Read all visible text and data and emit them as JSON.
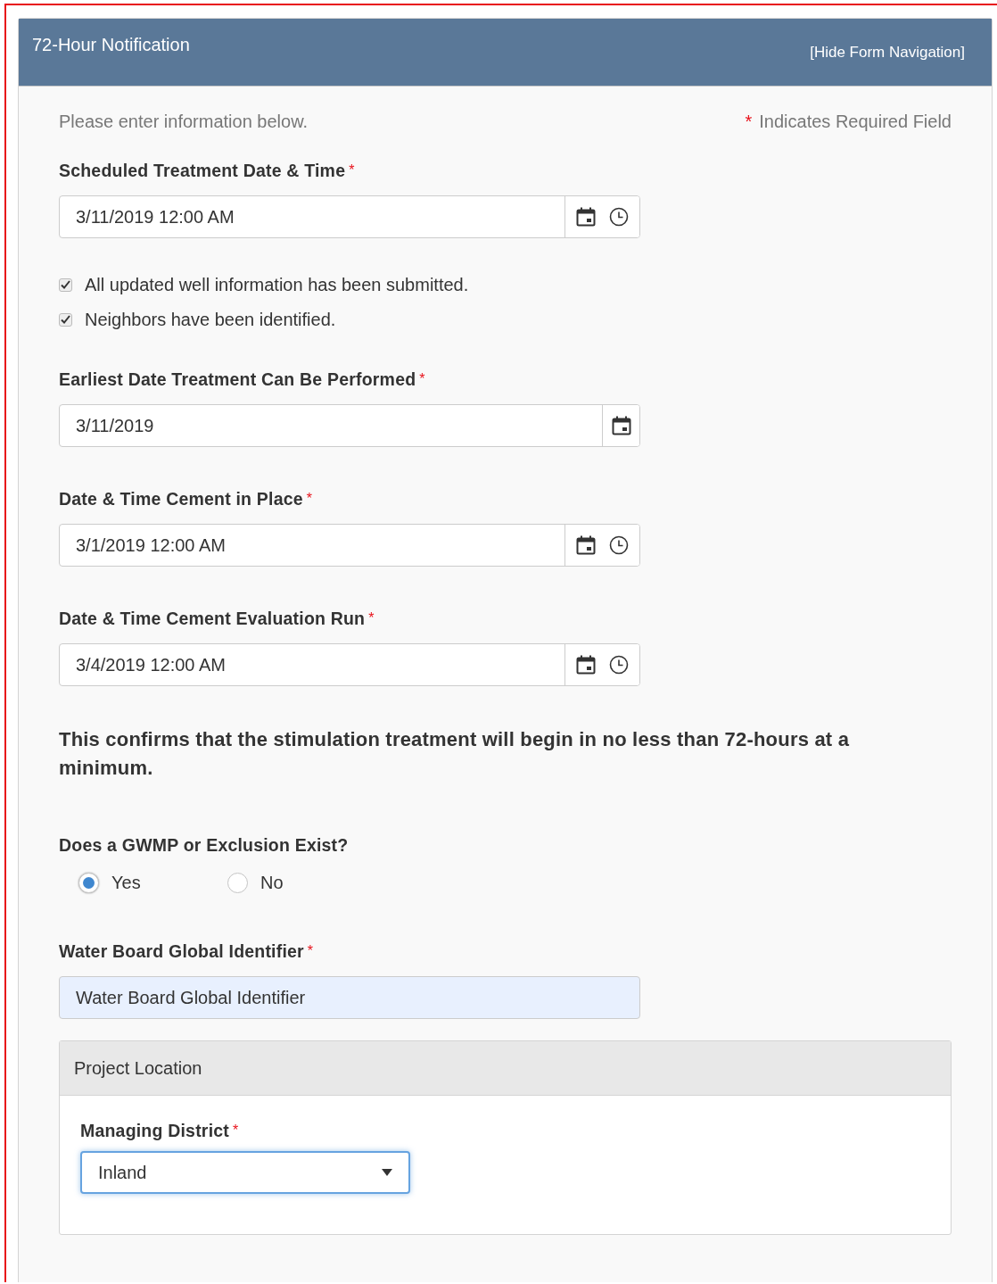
{
  "header": {
    "title": "72-Hour Notification",
    "nav_link": "[Hide Form Navigation]"
  },
  "intro": "Please enter information below.",
  "required_note": {
    "mark": "*",
    "text": "Indicates Required Field"
  },
  "fields": [
    {
      "kind": "datetime",
      "label": "Scheduled Treatment Date & Time",
      "required_mark": "*",
      "value": "3/11/2019 12:00 AM"
    },
    {
      "kind": "checkboxes",
      "items": [
        {
          "label": "All updated well information has been submitted.",
          "checked": true
        },
        {
          "label": "Neighbors have been identified.",
          "checked": true
        }
      ]
    },
    {
      "kind": "date",
      "label": "Earliest Date Treatment Can Be Performed",
      "required_mark": "*",
      "value": "3/11/2019"
    },
    {
      "kind": "datetime",
      "label": "Date & Time Cement in Place",
      "required_mark": "*",
      "value": "3/1/2019 12:00 AM"
    },
    {
      "kind": "datetime",
      "label": "Date & Time Cement Evaluation Run",
      "required_mark": "*",
      "value": "3/4/2019 12:00 AM"
    },
    {
      "kind": "statement",
      "text": "This confirms that the stimulation treatment will begin in no less than 72-hours at a minimum."
    },
    {
      "kind": "radio",
      "label": "Does a GWMP or Exclusion Exist?",
      "options": [
        {
          "label": "Yes",
          "selected": true
        },
        {
          "label": "No",
          "selected": false
        }
      ]
    },
    {
      "kind": "text",
      "label": "Water Board Global Identifier",
      "required_mark": "*",
      "value": "Water Board Global Identifier"
    }
  ],
  "section": {
    "title": "Project Location",
    "fields": [
      {
        "kind": "select",
        "label": "Managing District",
        "required_mark": "*",
        "value": "Inland"
      }
    ]
  }
}
